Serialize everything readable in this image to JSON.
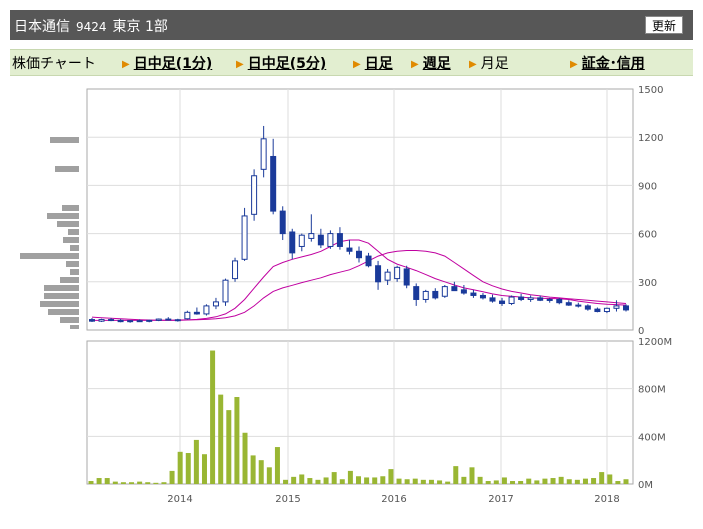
{
  "header": {
    "company": "日本通信",
    "code": "9424",
    "market": "東京 1部",
    "refresh_label": "更新"
  },
  "nav": {
    "label": "株価チャート",
    "items": [
      {
        "label": "日中足(1分)",
        "link": true
      },
      {
        "label": "日中足(5分)",
        "link": true
      },
      {
        "label": "日足",
        "link": true
      },
      {
        "label": "週足",
        "link": true
      },
      {
        "label": "月足",
        "link": false
      },
      {
        "label": "証金･信用",
        "link": true
      }
    ]
  },
  "colors": {
    "up_candle": "#ffffff",
    "down_candle": "#1a3a9a",
    "ma_short": "#c000a0",
    "volume": "#99b633",
    "header_bg": "#575757",
    "nav_bg": "#e2eed0"
  },
  "chart_data": [
    {
      "type": "candlestick",
      "title": "",
      "x_ticks": [
        "2014",
        "2015",
        "2016",
        "2017",
        "2018"
      ],
      "y_ticks": [
        "1500",
        "1200",
        "900",
        "600",
        "300",
        "0"
      ],
      "ylim": [
        0,
        1500
      ],
      "grid": true,
      "candles": [
        {
          "o": 65,
          "h": 75,
          "l": 50,
          "c": 55
        },
        {
          "o": 55,
          "h": 70,
          "l": 50,
          "c": 65
        },
        {
          "o": 65,
          "h": 75,
          "l": 55,
          "c": 60
        },
        {
          "o": 60,
          "h": 68,
          "l": 48,
          "c": 52
        },
        {
          "o": 52,
          "h": 62,
          "l": 45,
          "c": 58
        },
        {
          "o": 58,
          "h": 66,
          "l": 50,
          "c": 55
        },
        {
          "o": 55,
          "h": 64,
          "l": 48,
          "c": 60
        },
        {
          "o": 60,
          "h": 72,
          "l": 55,
          "c": 68
        },
        {
          "o": 68,
          "h": 80,
          "l": 60,
          "c": 64
        },
        {
          "o": 64,
          "h": 70,
          "l": 52,
          "c": 58
        },
        {
          "o": 70,
          "h": 120,
          "l": 65,
          "c": 110
        },
        {
          "o": 110,
          "h": 140,
          "l": 95,
          "c": 100
        },
        {
          "o": 100,
          "h": 160,
          "l": 90,
          "c": 150
        },
        {
          "o": 150,
          "h": 200,
          "l": 130,
          "c": 175
        },
        {
          "o": 175,
          "h": 320,
          "l": 150,
          "c": 310
        },
        {
          "o": 320,
          "h": 450,
          "l": 300,
          "c": 430
        },
        {
          "o": 440,
          "h": 760,
          "l": 430,
          "c": 710
        },
        {
          "o": 720,
          "h": 1000,
          "l": 680,
          "c": 960
        },
        {
          "o": 1000,
          "h": 1270,
          "l": 950,
          "c": 1190
        },
        {
          "o": 1080,
          "h": 1190,
          "l": 720,
          "c": 740
        },
        {
          "o": 740,
          "h": 770,
          "l": 560,
          "c": 600
        },
        {
          "o": 610,
          "h": 630,
          "l": 440,
          "c": 480
        },
        {
          "o": 520,
          "h": 600,
          "l": 490,
          "c": 590
        },
        {
          "o": 570,
          "h": 720,
          "l": 550,
          "c": 600
        },
        {
          "o": 590,
          "h": 630,
          "l": 510,
          "c": 530
        },
        {
          "o": 520,
          "h": 620,
          "l": 505,
          "c": 600
        },
        {
          "o": 600,
          "h": 640,
          "l": 500,
          "c": 520
        },
        {
          "o": 510,
          "h": 560,
          "l": 470,
          "c": 490
        },
        {
          "o": 490,
          "h": 520,
          "l": 420,
          "c": 450
        },
        {
          "o": 460,
          "h": 480,
          "l": 390,
          "c": 400
        },
        {
          "o": 400,
          "h": 430,
          "l": 250,
          "c": 300
        },
        {
          "o": 310,
          "h": 380,
          "l": 280,
          "c": 360
        },
        {
          "o": 320,
          "h": 400,
          "l": 300,
          "c": 390
        },
        {
          "o": 380,
          "h": 400,
          "l": 260,
          "c": 280
        },
        {
          "o": 270,
          "h": 290,
          "l": 150,
          "c": 190
        },
        {
          "o": 190,
          "h": 250,
          "l": 170,
          "c": 240
        },
        {
          "o": 240,
          "h": 260,
          "l": 190,
          "c": 200
        },
        {
          "o": 210,
          "h": 280,
          "l": 200,
          "c": 270
        },
        {
          "o": 270,
          "h": 300,
          "l": 250,
          "c": 245
        },
        {
          "o": 250,
          "h": 280,
          "l": 220,
          "c": 230
        },
        {
          "o": 230,
          "h": 250,
          "l": 200,
          "c": 215
        },
        {
          "o": 215,
          "h": 230,
          "l": 190,
          "c": 200
        },
        {
          "o": 200,
          "h": 220,
          "l": 170,
          "c": 180
        },
        {
          "o": 180,
          "h": 200,
          "l": 150,
          "c": 165
        },
        {
          "o": 165,
          "h": 215,
          "l": 155,
          "c": 205
        },
        {
          "o": 205,
          "h": 225,
          "l": 180,
          "c": 190
        },
        {
          "o": 190,
          "h": 215,
          "l": 175,
          "c": 200
        },
        {
          "o": 200,
          "h": 215,
          "l": 180,
          "c": 185
        },
        {
          "o": 185,
          "h": 200,
          "l": 170,
          "c": 190
        },
        {
          "o": 190,
          "h": 200,
          "l": 160,
          "c": 170
        },
        {
          "o": 170,
          "h": 185,
          "l": 150,
          "c": 155
        },
        {
          "o": 155,
          "h": 170,
          "l": 140,
          "c": 150
        },
        {
          "o": 150,
          "h": 160,
          "l": 120,
          "c": 130
        },
        {
          "o": 130,
          "h": 140,
          "l": 110,
          "c": 115
        },
        {
          "o": 115,
          "h": 140,
          "l": 105,
          "c": 135
        },
        {
          "o": 135,
          "h": 185,
          "l": 115,
          "c": 150
        },
        {
          "o": 150,
          "h": 160,
          "l": 115,
          "c": 125
        }
      ],
      "ma_short": [
        80,
        76,
        73,
        70,
        67,
        64,
        62,
        61,
        60,
        60,
        62,
        66,
        72,
        82,
        100,
        135,
        190,
        260,
        330,
        395,
        420,
        440,
        455,
        470,
        490,
        520,
        550,
        560,
        560,
        540,
        490,
        440,
        410,
        390,
        370,
        345,
        320,
        300,
        280,
        262,
        250,
        238,
        225,
        215,
        210,
        205,
        200,
        198,
        196,
        194,
        190,
        180,
        172,
        165,
        160,
        158,
        155
      ],
      "ma_long": [
        60,
        60,
        60,
        60,
        60,
        60,
        60,
        61,
        61,
        62,
        63,
        64,
        66,
        70,
        76,
        88,
        110,
        150,
        200,
        240,
        262,
        278,
        295,
        310,
        325,
        345,
        360,
        375,
        400,
        430,
        460,
        480,
        490,
        495,
        495,
        490,
        480,
        460,
        420,
        380,
        340,
        300,
        275,
        255,
        240,
        230,
        220,
        212,
        205,
        200,
        195,
        190,
        185,
        180,
        175,
        170,
        165
      ]
    },
    {
      "type": "bar",
      "title": "",
      "y_ticks": [
        "1200M",
        "800M",
        "400M",
        "0M"
      ],
      "ylim": [
        0,
        1200
      ],
      "values": [
        25,
        50,
        50,
        20,
        15,
        15,
        20,
        15,
        10,
        15,
        110,
        270,
        260,
        370,
        250,
        1120,
        750,
        620,
        730,
        430,
        240,
        200,
        140,
        310,
        35,
        60,
        80,
        50,
        35,
        55,
        100,
        40,
        110,
        65,
        55,
        55,
        65,
        125,
        45,
        40,
        45,
        35,
        35,
        30,
        20,
        150,
        60,
        140,
        60,
        25,
        30,
        55,
        25,
        25,
        45,
        30,
        45,
        50,
        60,
        40,
        35,
        45,
        50,
        100,
        80,
        25,
        40
      ]
    }
  ]
}
